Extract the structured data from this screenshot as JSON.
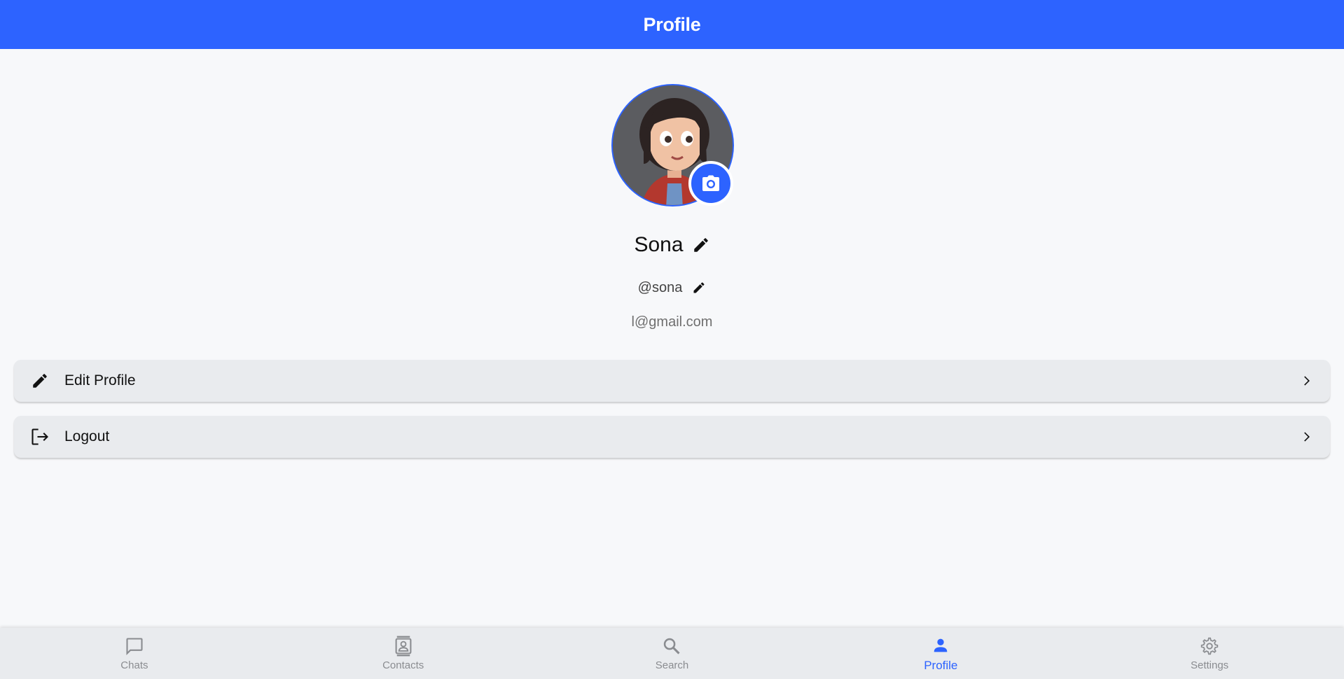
{
  "app_bar": {
    "title": "Profile"
  },
  "profile": {
    "name": "Sona",
    "username": "@sona",
    "email": "l@gmail.com"
  },
  "menu": [
    {
      "label": "Edit Profile",
      "icon": "pencil-icon"
    },
    {
      "label": "Logout",
      "icon": "logout-icon"
    }
  ],
  "bottom_nav": [
    {
      "label": "Chats",
      "icon": "chat-bubble-icon",
      "active": false
    },
    {
      "label": "Contacts",
      "icon": "contacts-icon",
      "active": false
    },
    {
      "label": "Search",
      "icon": "search-icon",
      "active": false
    },
    {
      "label": "Profile",
      "icon": "person-icon",
      "active": true
    },
    {
      "label": "Settings",
      "icon": "gear-icon",
      "active": false
    }
  ],
  "colors": {
    "accent": "#2d63ff",
    "background": "#f7f8fa",
    "card": "#e9ebee",
    "inactive": "#8a8c90"
  }
}
